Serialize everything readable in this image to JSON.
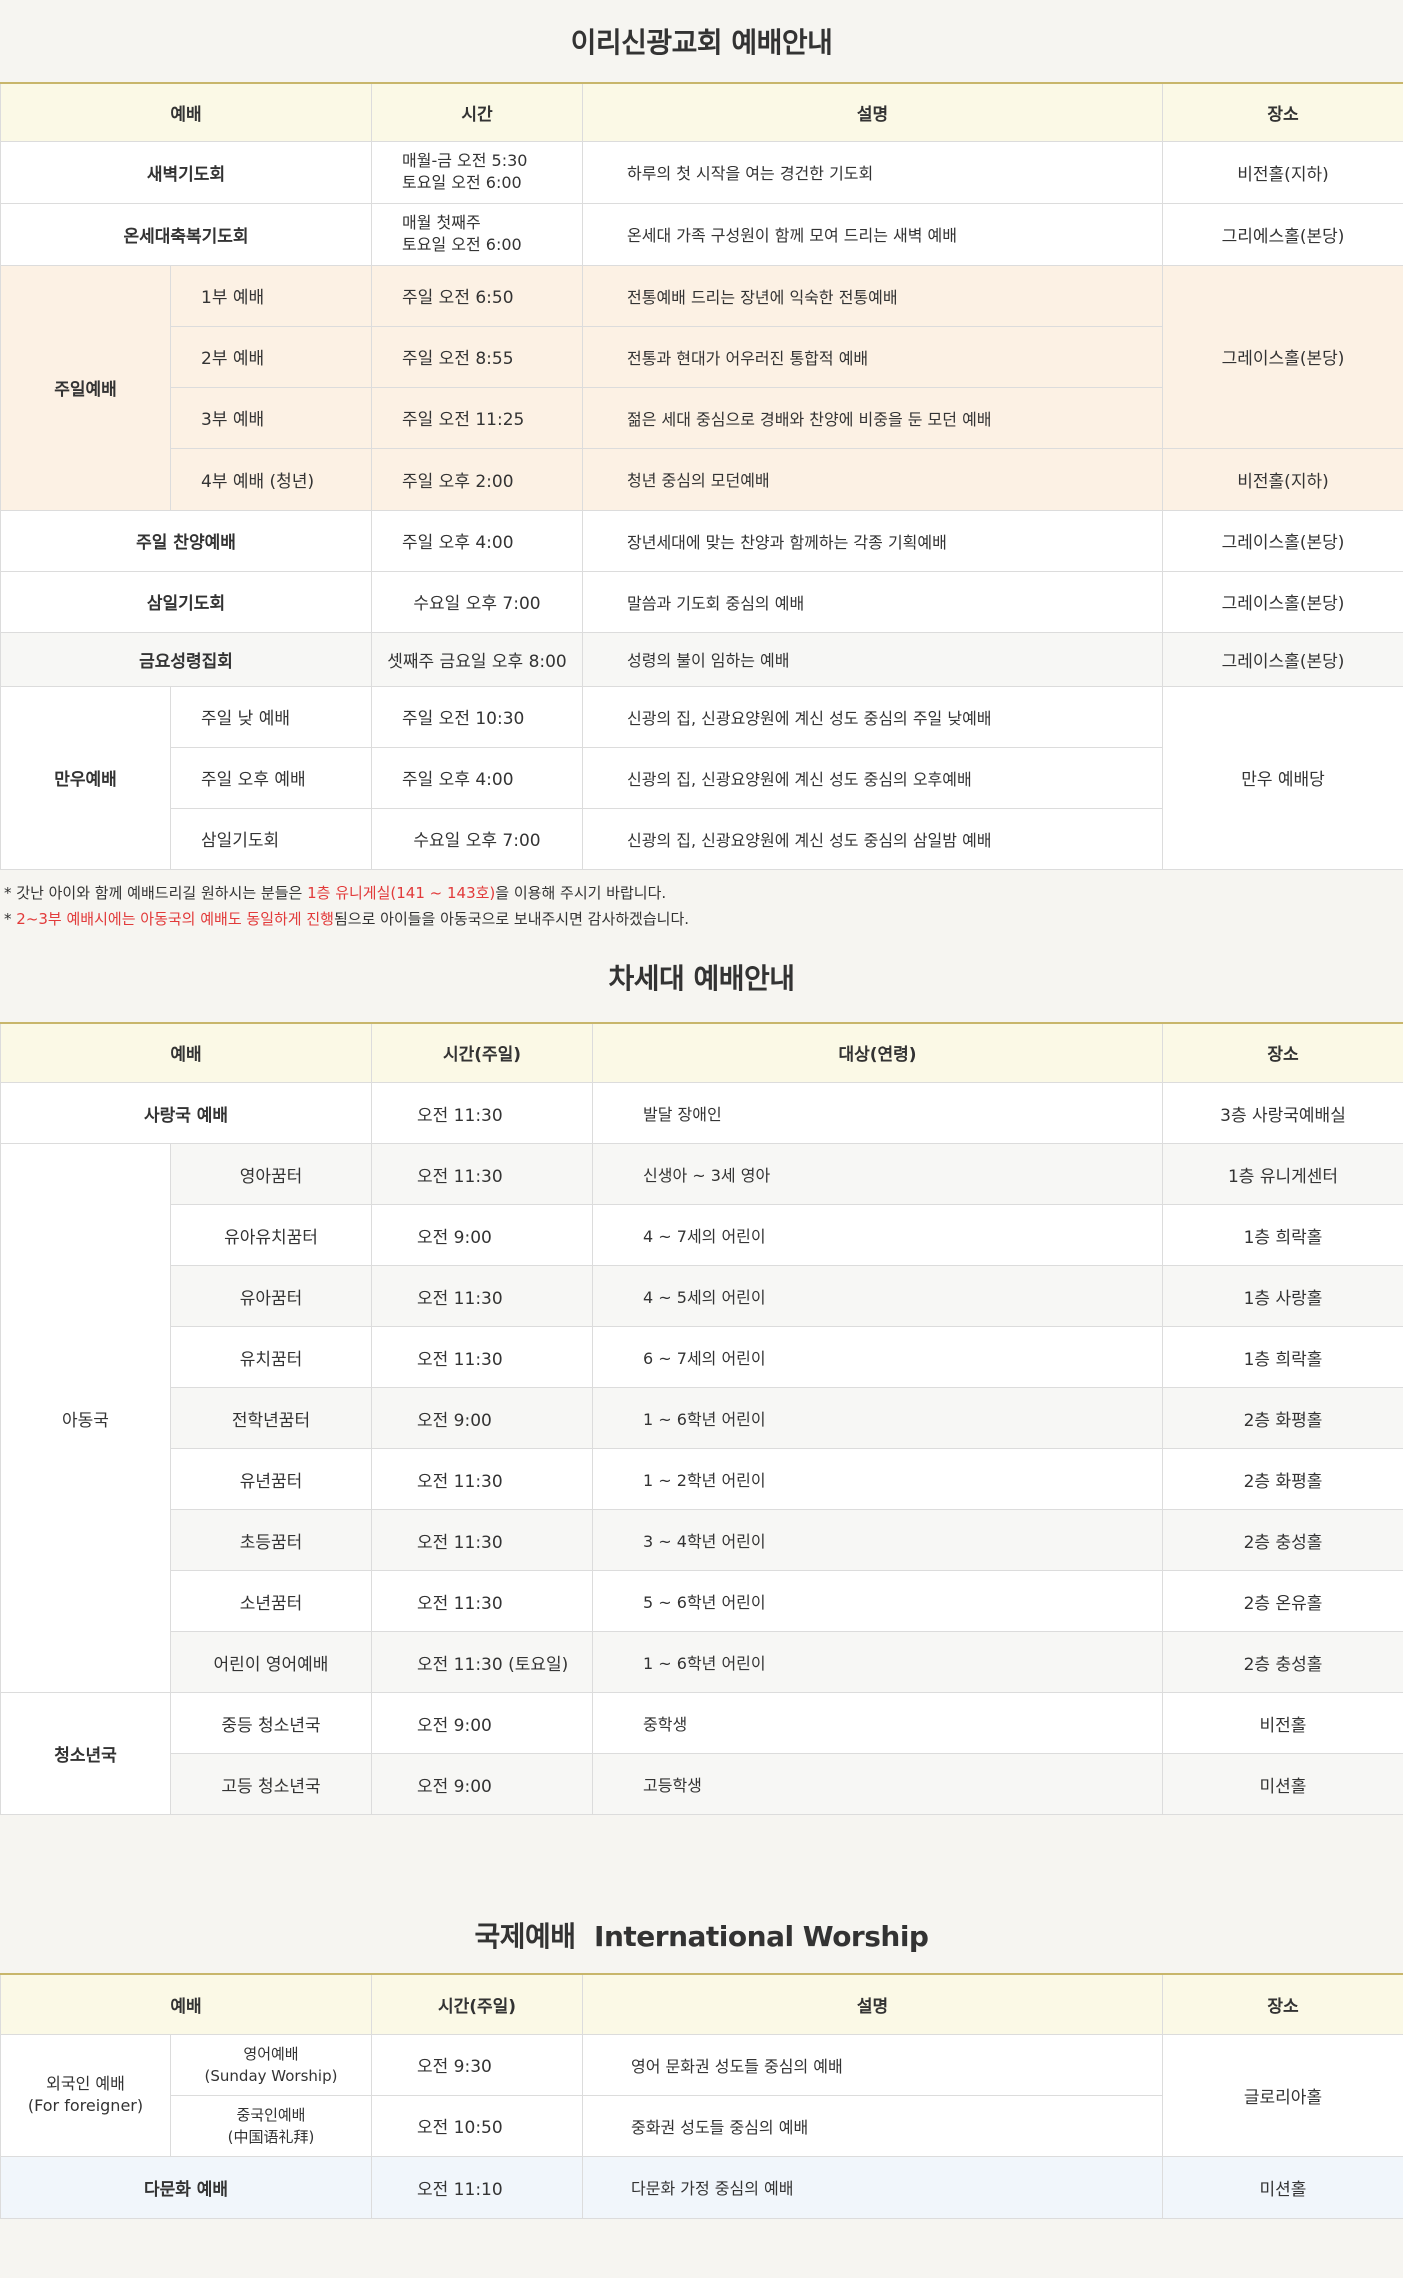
{
  "section1": {
    "title": "이리신광교회 예배안내",
    "headers": [
      "예배",
      "시간",
      "설명",
      "장소"
    ],
    "rows": {
      "dawn": {
        "name": "새벽기도회",
        "time1": "매월-금 오전 5:30",
        "time2": "토요일 오전 6:00",
        "desc": "하루의 첫 시작을 여는 경건한 기도회",
        "place": "비전홀(지하)"
      },
      "family": {
        "name": "온세대축복기도회",
        "time1": "매월 첫째주",
        "time2": "토요일 오전 6:00",
        "desc": "온세대 가족 구성원이 함께 모여 드리는 새벽 예배",
        "place": "그리에스홀(본당)"
      },
      "sunday": {
        "group": "주일예배",
        "items": [
          {
            "name": "1부 예배",
            "time": "주일 오전 6:50",
            "desc": "전통예배 드리는 장년에 익숙한 전통예배"
          },
          {
            "name": "2부 예배",
            "time": "주일 오전 8:55",
            "desc": "전통과 현대가 어우러진 통합적 예배"
          },
          {
            "name": "3부 예배",
            "time": "주일 오전 11:25",
            "desc": "젊은 세대 중심으로 경배와 찬양에 비중을 둔 모던 예배"
          },
          {
            "name": "4부 예배 (청년)",
            "time": "주일 오후 2:00",
            "desc": "청년 중심의 모던예배"
          }
        ],
        "place_main": "그레이스홀(본당)",
        "place_youth": "비전홀(지하)"
      },
      "praise": {
        "name": "주일 찬양예배",
        "time": "주일 오후 4:00",
        "desc": "장년세대에 맞는 찬양과 함께하는 각종 기획예배",
        "place": "그레이스홀(본당)"
      },
      "wednesday": {
        "name": "삼일기도회",
        "time": "수요일 오후 7:00",
        "desc": "말씀과 기도회 중심의 예배",
        "place": "그레이스홀(본당)"
      },
      "friday": {
        "name": "금요성령집회",
        "time": "셋째주 금요일 오후 8:00",
        "desc": "성령의 불이 임하는 예배",
        "place": "그레이스홀(본당)"
      },
      "manwoo": {
        "group": "만우예배",
        "items": [
          {
            "name": "주일 낮 예배",
            "time": "주일 오전 10:30",
            "desc": "신광의 집, 신광요양원에 계신 성도 중심의 주일 낮예배"
          },
          {
            "name": "주일 오후 예배",
            "time": "주일 오후 4:00",
            "desc": "신광의 집, 신광요양원에 계신 성도 중심의 오후예배"
          },
          {
            "name": "삼일기도회",
            "time": "수요일 오후 7:00",
            "desc": "신광의 집, 신광요양원에 계신 성도 중심의 삼일밤 예배"
          }
        ],
        "place": "만우 예배당"
      }
    },
    "note1_pre": "* 갓난 아이와 함께 예배드리길 원하시는 분들은 ",
    "note1_red": "1층 유니게실(141 ~ 143호)",
    "note1_post": "을 이용해 주시기 바랍니다.",
    "note2_pre": "* ",
    "note2_red": "2~3부 예배시에는 아동국의 예배도 동일하게 진행",
    "note2_post": "됨으로 아이들을 아동국으로 보내주시면 감사하겠습니다."
  },
  "section2": {
    "title": "차세대 예배안내",
    "headers": [
      "예배",
      "시간(주일)",
      "대상(연령)",
      "장소"
    ],
    "love": {
      "name": "사랑국 예배",
      "time": "오전 11:30",
      "target": "발달 장애인",
      "place": "3층 사랑국예배실"
    },
    "children": {
      "group": "아동국",
      "items": [
        {
          "name": "영아꿈터",
          "time": "오전 11:30",
          "target": "신생아 ~ 3세 영아",
          "place": "1층 유니게센터"
        },
        {
          "name": "유아유치꿈터",
          "time": "오전 9:00",
          "target": "4 ~ 7세의 어린이",
          "place": "1층 희락홀"
        },
        {
          "name": "유아꿈터",
          "time": "오전 11:30",
          "target": "4 ~ 5세의 어린이",
          "place": "1층 사랑홀"
        },
        {
          "name": "유치꿈터",
          "time": "오전 11:30",
          "target": "6 ~ 7세의 어린이",
          "place": "1층 희락홀"
        },
        {
          "name": "전학년꿈터",
          "time": "오전 9:00",
          "target": "1 ~ 6학년 어린이",
          "place": "2층 화평홀"
        },
        {
          "name": "유년꿈터",
          "time": "오전 11:30",
          "target": "1 ~ 2학년 어린이",
          "place": "2층 화평홀"
        },
        {
          "name": "초등꿈터",
          "time": "오전 11:30",
          "target": "3 ~ 4학년 어린이",
          "place": "2층 충성홀"
        },
        {
          "name": "소년꿈터",
          "time": "오전 11:30",
          "target": "5 ~ 6학년 어린이",
          "place": "2층 온유홀"
        },
        {
          "name": "어린이 영어예배",
          "time": "오전 11:30 (토요일)",
          "target": "1 ~ 6학년 어린이",
          "place": "2층 충성홀"
        }
      ]
    },
    "youth": {
      "group": "청소년국",
      "items": [
        {
          "name": "중등 청소년국",
          "time": "오전 9:00",
          "target": "중학생",
          "place": "비전홀"
        },
        {
          "name": "고등 청소년국",
          "time": "오전 9:00",
          "target": "고등학생",
          "place": "미션홀"
        }
      ]
    }
  },
  "section3": {
    "title": "국제예배  International Worship",
    "headers": [
      "예배",
      "시간(주일)",
      "설명",
      "장소"
    ],
    "foreign": {
      "group1": "외국인 예배",
      "group2": "(For foreigner)",
      "items": [
        {
          "name1": "영어예배",
          "name2": "(Sunday Worship)",
          "time": "오전 9:30",
          "desc": "영어 문화권 성도들 중심의 예배"
        },
        {
          "name1": "중국인예배",
          "name2": "(中国语礼拜)",
          "time": "오전 10:50",
          "desc": "중화권 성도들 중심의 예배"
        }
      ],
      "place": "글로리아홀"
    },
    "multi": {
      "name": "다문화 예배",
      "time": "오전 11:10",
      "desc": "다문화 가정 중심의 예배",
      "place": "미션홀"
    }
  }
}
